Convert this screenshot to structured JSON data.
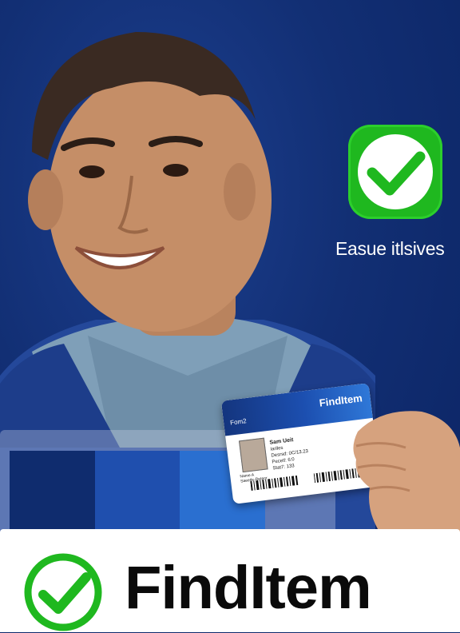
{
  "headline": {
    "tagline": "Easue itlsives"
  },
  "card": {
    "brand": "FindItem",
    "corner_label": "Fom2",
    "name_line": "Sam Ueit",
    "detail_lines": [
      "Iarlles",
      "Desrsd: 0C/13.23",
      "Pecetl: 6:0",
      "Stat7: 133"
    ],
    "side_lines": [
      "Name A",
      "Saeetle-Reteor"
    ]
  },
  "footer": {
    "brand_name": "FindItem"
  },
  "colors": {
    "background": "#0d2a6b",
    "accent_green": "#1fb81f",
    "card_blue": "#1c4fb0",
    "footer_bg": "#ffffff",
    "footer_text": "#0a0a0a"
  },
  "icons": [
    "check-badge-icon",
    "check-circle-icon"
  ]
}
